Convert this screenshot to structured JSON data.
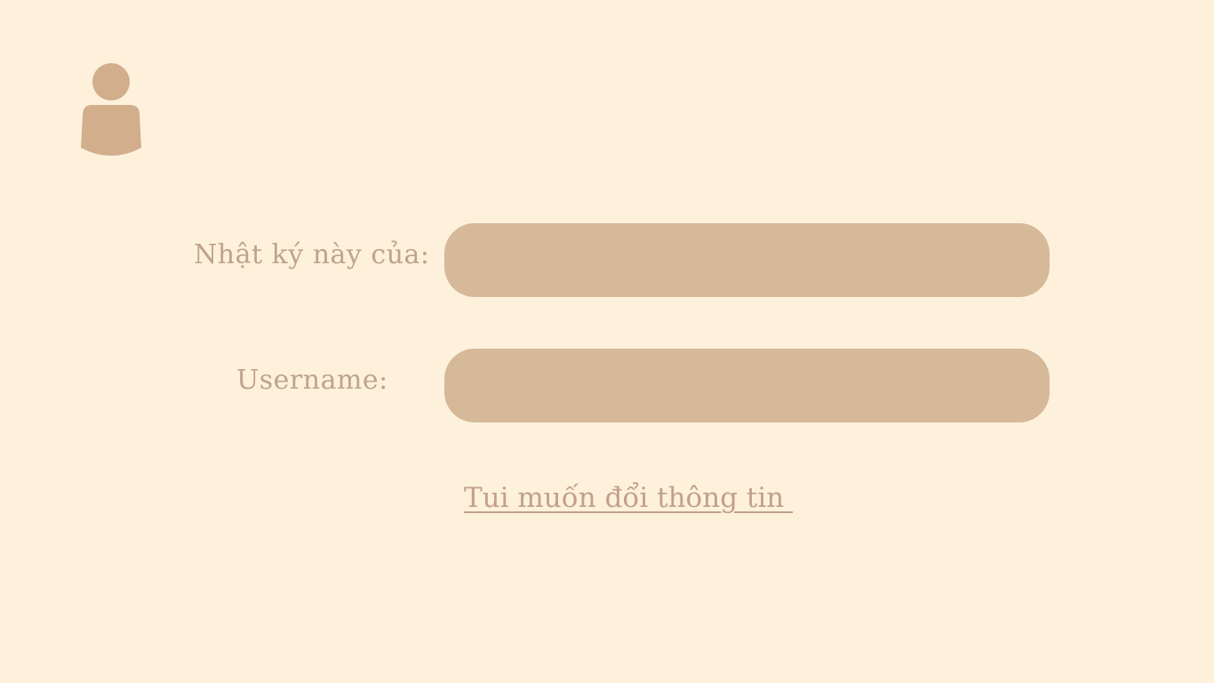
{
  "colors": {
    "background": "#fdf1dc",
    "icon": "#d2ae8c",
    "field": "#d6b999",
    "label_text": "#bfa38c",
    "link_text": "#c2a08a"
  },
  "header": {
    "icon": "user-icon"
  },
  "form": {
    "owner_label": "Nhật ký này của:",
    "owner_value": "",
    "username_label": "Username:",
    "username_value": ""
  },
  "actions": {
    "change_info_link": "Tui muốn đổi thông tin "
  }
}
